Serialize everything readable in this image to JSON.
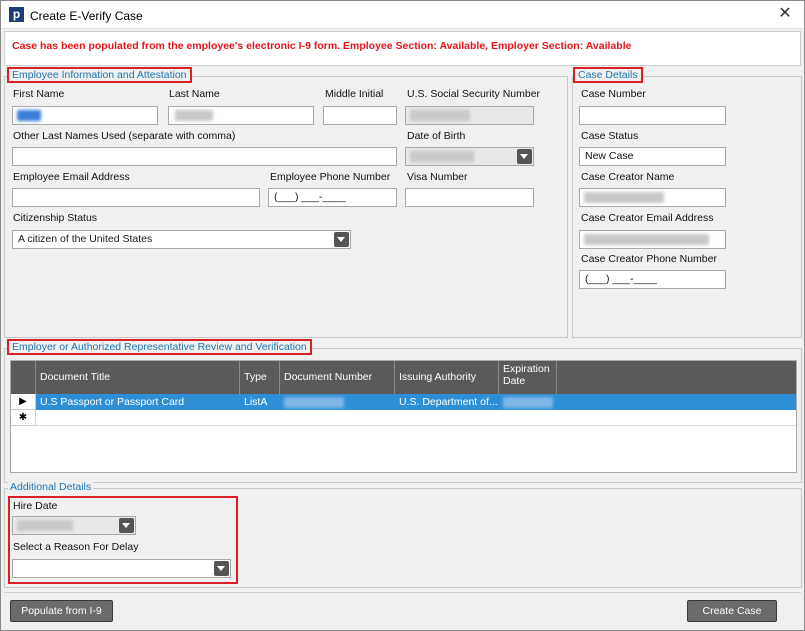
{
  "window": {
    "title": "Create E-Verify Case",
    "logo_letter": "p"
  },
  "banner": {
    "message": "Case has been populated from the employee's electronic I-9 form. Employee Section: Available, Employer Section: Available"
  },
  "employee": {
    "legend": "Employee Information and Attestation",
    "first_name_label": "First Name",
    "last_name_label": "Last Name",
    "middle_initial_label": "Middle Initial",
    "ssn_label": "U.S. Social Security Number",
    "other_last_names_label": "Other Last Names Used (separate with comma)",
    "dob_label": "Date of Birth",
    "email_label": "Employee Email Address",
    "phone_label": "Employee Phone Number",
    "phone_value": "(___) ___-____",
    "visa_label": "Visa Number",
    "citizenship_label": "Citizenship Status",
    "citizenship_value": "A citizen of the United States"
  },
  "case_details": {
    "legend": "Case Details",
    "case_number_label": "Case Number",
    "case_status_label": "Case Status",
    "case_status_value": "New Case",
    "creator_name_label": "Case Creator Name",
    "creator_email_label": "Case Creator Email Address",
    "creator_phone_label": "Case Creator Phone Number",
    "creator_phone_value": "(___) ___-____"
  },
  "employer": {
    "legend": "Employer or Authorized Representative Review and Verification",
    "columns": [
      "Document Title",
      "Type",
      "Document Number",
      "Issuing Authority",
      "Expiration Date"
    ],
    "rows": [
      {
        "title": "U.S Passport or Passport Card",
        "type": "ListA",
        "issuing": "U.S. Department of..."
      }
    ],
    "row_marker": "▶",
    "new_row_marker": "✱"
  },
  "additional": {
    "legend": "Additional Details",
    "hire_date_label": "Hire Date",
    "delay_reason_label": "Select a Reason For Delay"
  },
  "buttons": {
    "populate": "Populate from I-9",
    "create": "Create Case"
  },
  "colors": {
    "accent_blue": "#1f76b3",
    "highlight_red": "#d92026",
    "banner_red": "#e8141a",
    "selection_blue": "#2f8fd6"
  }
}
